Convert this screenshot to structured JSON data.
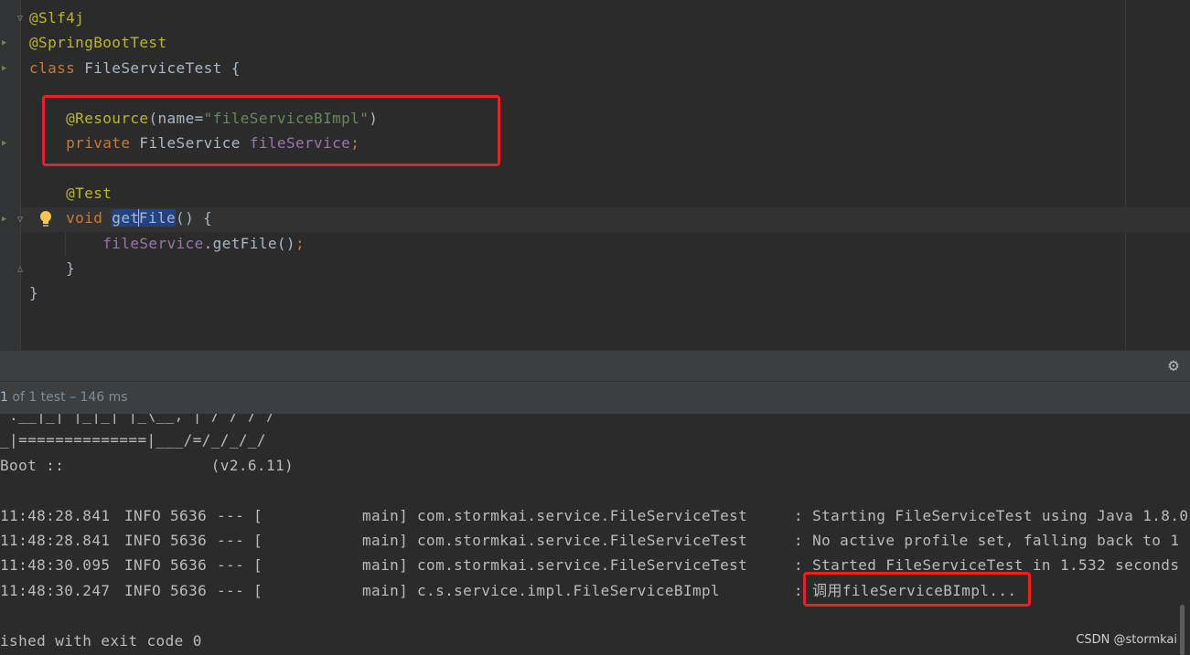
{
  "editor": {
    "lines": [
      [
        {
          "t": "@Slf4j",
          "c": "ann"
        }
      ],
      [
        {
          "t": "@SpringBootTest",
          "c": "ann"
        }
      ],
      [
        {
          "t": "class ",
          "c": "kw"
        },
        {
          "t": "FileServiceTest {",
          "c": ""
        }
      ],
      [],
      [
        {
          "t": "    @Resource",
          "c": "ann"
        },
        {
          "t": "(name=",
          "c": ""
        },
        {
          "t": "\"fileServiceBImpl\"",
          "c": "str"
        },
        {
          "t": ")",
          "c": ""
        }
      ],
      [
        {
          "t": "    private ",
          "c": "kw"
        },
        {
          "t": "FileService ",
          "c": ""
        },
        {
          "t": "fileService",
          "c": "fld"
        },
        {
          "t": ";",
          "c": "kw"
        }
      ],
      [],
      [
        {
          "t": "    @Test",
          "c": "ann"
        }
      ],
      [
        {
          "t": "    void ",
          "c": "kw"
        },
        {
          "t": "get",
          "c": "sel"
        },
        {
          "t": "",
          "c": "caret"
        },
        {
          "t": "File",
          "c": "sel"
        },
        {
          "t": "() {",
          "c": ""
        }
      ],
      [
        {
          "t": "        fileService",
          "c": "fld"
        },
        {
          "t": ".getFile()",
          "c": ""
        },
        {
          "t": ";",
          "c": "kw"
        }
      ],
      [
        {
          "t": "    }",
          "c": ""
        }
      ],
      [
        {
          "t": "}",
          "c": ""
        }
      ]
    ]
  },
  "toolbar": {
    "settings_icon": "gear-icon"
  },
  "test_status": {
    "prefix": "1",
    "suffix": " of 1 test – 146 ms"
  },
  "console": {
    "banner": [
      "'.__|_| |_|_| |_\\__, | / / / /",
      "_|==============|___/=/_/_/_/",
      "Boot ::                (v2.6.11)",
      ""
    ],
    "log": [
      {
        "time": "11:48:28.841",
        "level": "INFO",
        "pid": "5636",
        "sep": "--- [",
        "thread": "main]",
        "logger": "com.stormkai.service.FileServiceTest",
        "msg": ": Starting FileServiceTest using Java 1.8.0"
      },
      {
        "time": "11:48:28.841",
        "level": "INFO",
        "pid": "5636",
        "sep": "--- [",
        "thread": "main]",
        "logger": "com.stormkai.service.FileServiceTest",
        "msg": ": No active profile set, falling back to 1"
      },
      {
        "time": "11:48:30.095",
        "level": "INFO",
        "pid": "5636",
        "sep": "--- [",
        "thread": "main]",
        "logger": "com.stormkai.service.FileServiceTest",
        "msg": ": Started FileServiceTest in 1.532 seconds"
      },
      {
        "time": "11:48:30.247",
        "level": "INFO",
        "pid": "5636",
        "sep": "--- [",
        "thread": "main]",
        "logger": "c.s.service.impl.FileServiceBImpl",
        "msg": ": 调用fileServiceBImpl..."
      }
    ],
    "exit_line": "ished with exit code 0"
  },
  "watermark": "CSDN @stormkai",
  "colors": {
    "highlight_box": "#e8231f",
    "annotation": "#bbb529",
    "keyword": "#cc7832",
    "string": "#6a8759",
    "field": "#9876aa"
  }
}
